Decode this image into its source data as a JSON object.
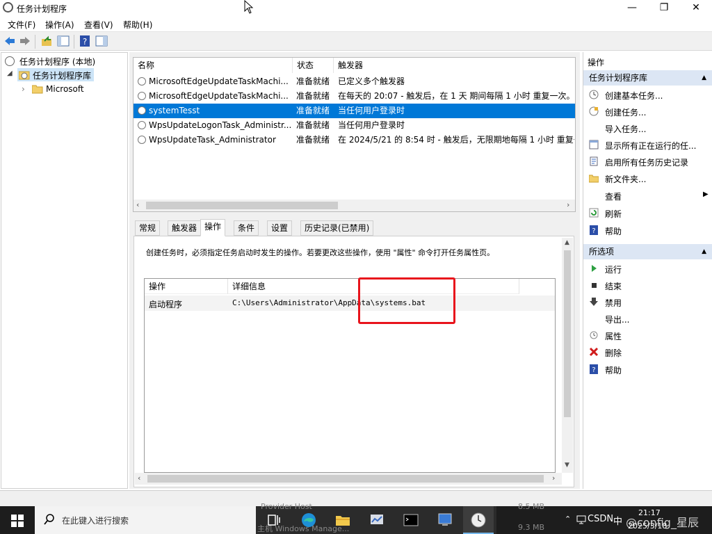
{
  "window": {
    "title": "任务计划程序",
    "minimize": "—",
    "maximize": "❐",
    "close": "✕"
  },
  "menu": [
    {
      "label": "文件(F)"
    },
    {
      "label": "操作(A)"
    },
    {
      "label": "查看(V)"
    },
    {
      "label": "帮助(H)"
    }
  ],
  "tree": {
    "root": "任务计划程序 (本地)",
    "library": "任务计划程序库",
    "child": "Microsoft"
  },
  "tasks": {
    "columns": [
      "名称",
      "状态",
      "触发器"
    ],
    "rows": [
      {
        "name": "MicrosoftEdgeUpdateTaskMachi...",
        "status": "准备就绪",
        "trigger": "已定义多个触发器"
      },
      {
        "name": "MicrosoftEdgeUpdateTaskMachi...",
        "status": "准备就绪",
        "trigger": "在每天的 20:07 - 触发后，在 1 天 期间每隔 1 小时 重复一次。"
      },
      {
        "name": "systemTesst",
        "status": "准备就绪",
        "trigger": "当任何用户登录时"
      },
      {
        "name": "WpsUpdateLogonTask_Administr...",
        "status": "准备就绪",
        "trigger": "当任何用户登录时"
      },
      {
        "name": "WpsUpdateTask_Administrator",
        "status": "准备就绪",
        "trigger": "在 2024/5/21 的 8:54 时 - 触发后，无限期地每隔 1 小时 重复一"
      }
    ]
  },
  "tabs": [
    {
      "label": "常规"
    },
    {
      "label": "触发器"
    },
    {
      "label": "操作"
    },
    {
      "label": "条件"
    },
    {
      "label": "设置"
    },
    {
      "label": "历史记录(已禁用)"
    }
  ],
  "actions_panel": {
    "description": "创建任务时，必须指定任务启动时发生的操作。若要更改这些操作，使用 \"属性\" 命令打开任务属性页。",
    "columns": [
      "操作",
      "详细信息"
    ],
    "rows": [
      {
        "action": "启动程序",
        "details": "C:\\Users\\Administrator\\AppData\\systems.bat"
      }
    ]
  },
  "right_pane": {
    "header": "操作",
    "section1": "任务计划程序库",
    "items1": [
      {
        "label": "创建基本任务...",
        "icon": "create-basic-task-icon"
      },
      {
        "label": "创建任务...",
        "icon": "create-task-icon"
      },
      {
        "label": "导入任务...",
        "icon": ""
      },
      {
        "label": "显示所有正在运行的任...",
        "icon": "running-tasks-icon"
      },
      {
        "label": "启用所有任务历史记录",
        "icon": "history-icon"
      },
      {
        "label": "新文件夹...",
        "icon": "folder-icon"
      },
      {
        "label": "查看",
        "icon": ""
      },
      {
        "label": "刷新",
        "icon": "refresh-icon"
      },
      {
        "label": "帮助",
        "icon": "help-icon"
      }
    ],
    "section2": "所选项",
    "items2": [
      {
        "label": "运行",
        "icon": "run-icon"
      },
      {
        "label": "结束",
        "icon": "stop-icon"
      },
      {
        "label": "禁用",
        "icon": "disable-icon"
      },
      {
        "label": "导出...",
        "icon": ""
      },
      {
        "label": "属性",
        "icon": "properties-icon"
      },
      {
        "label": "删除",
        "icon": "delete-icon"
      },
      {
        "label": "帮助",
        "icon": "help-icon"
      }
    ]
  },
  "taskbar": {
    "search_placeholder": "在此键入进行搜索",
    "bg_text1": "Provider Host",
    "bg_text2": "主机 Windows Manage...",
    "bg_size1": "8.5 MB",
    "bg_size2": "9.3 MB",
    "tray_lang": "中",
    "tray_text": "CSDN",
    "watermark": "@config_星辰",
    "time": "21:17",
    "date": "2025/3/18"
  },
  "colors": {
    "selection": "#0078d7",
    "highlight_box": "#e8141c",
    "section_bg": "#dce6f4"
  }
}
